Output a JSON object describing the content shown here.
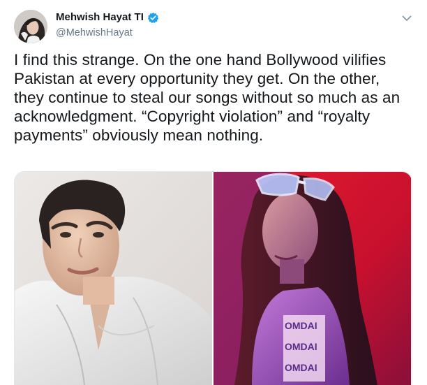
{
  "tweet": {
    "display_name": "Mehwish Hayat TI",
    "handle": "@MehwishHayat",
    "verified": true,
    "text_lines": [
      "I find this strange. On the one hand Bollywood vilifies",
      "Pakistan at every opportunity they get. On the other,",
      "they continue to steal our songs without so much as an",
      "acknowledgment. “Copyright violation” and “royalty",
      "payments” obviously mean nothing."
    ],
    "shirt_print": "OMDAI"
  },
  "icons": {
    "verified": "verified-badge-icon",
    "caret": "chevron-down-icon"
  },
  "colors": {
    "verified_blue": "#1da1f2",
    "text": "#14171a",
    "secondary_text": "#657786",
    "border": "#e1e8ed"
  }
}
